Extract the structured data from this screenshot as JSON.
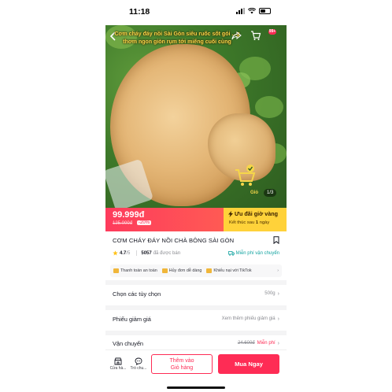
{
  "status_bar": {
    "time": "11:18"
  },
  "hero": {
    "caption_line1": "Cơm cháy đáy nồi Sài Gòn siêu ruốc sốt gói ...g",
    "caption_line2": "thơm ngon giòn rụm tới miếng cuối cùng",
    "cart_badge": "99+",
    "cart_label": "Giỏ",
    "page_count": "1/3"
  },
  "price": {
    "current": "99.999đ",
    "original": "125.000đ",
    "discount": "-20%"
  },
  "flash_sale": {
    "title": "Ưu đãi giờ vàng",
    "ends_prefix": "Kết thúc sau",
    "ends_value": "1",
    "ends_suffix": "ngày"
  },
  "product": {
    "title": "CƠM CHÁY ĐÁY NỒI CHÀ BÔNG SÀI GÒN",
    "rating": "4.7",
    "rating_max": "/5",
    "sold_count": "5057",
    "sold_label": "đã được bán",
    "free_shipping": "Miễn phí vận chuyển"
  },
  "assurances": [
    "Thanh toán an toàn",
    "Hủy đơn dễ dàng",
    "Khiếu nại với TikTok"
  ],
  "options": {
    "label": "Chọn các tùy chọn",
    "value": "500g"
  },
  "voucher": {
    "label": "Phiếu giảm giá",
    "value": "Xem thêm phiếu giảm giá"
  },
  "shipping": {
    "label": "Vận chuyển",
    "original": "24.600đ",
    "value": "Miễn phí"
  },
  "bottom_bar": {
    "shop_label": "Cửa hà...",
    "chat_label": "Trò chu...",
    "add_cart_line1": "Thêm vào",
    "add_cart_line2": "Giỏ hàng",
    "buy_now": "Mua Ngay"
  },
  "colors": {
    "accent": "#fe2c55",
    "flash": "#ffd23a",
    "teal": "#12a3a0"
  }
}
